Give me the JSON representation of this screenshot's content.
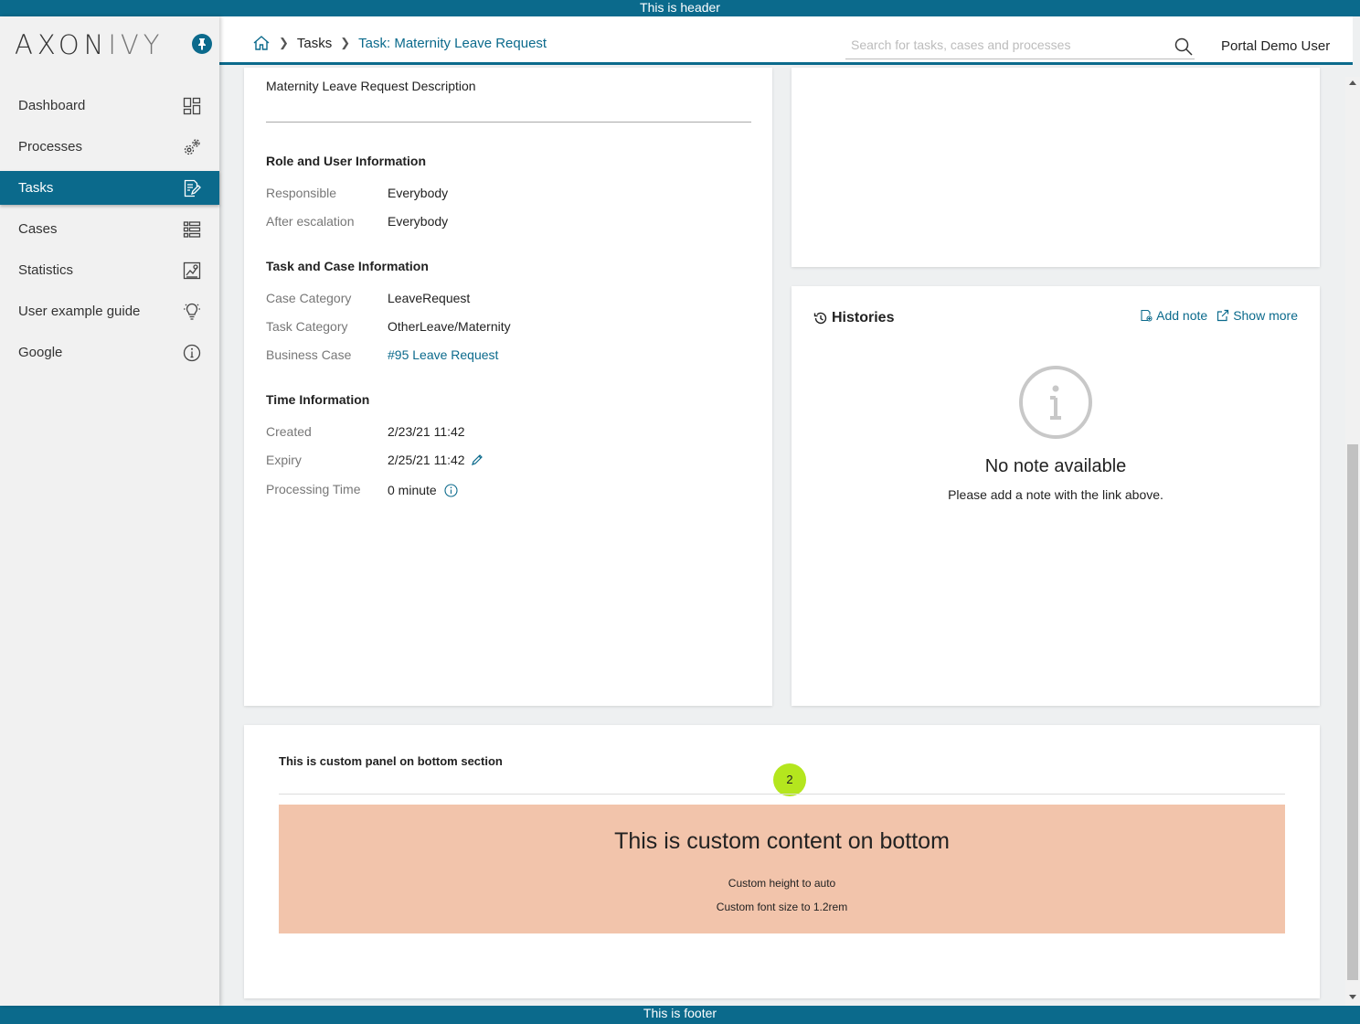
{
  "banners": {
    "header": "This is header",
    "footer": "This is footer"
  },
  "logo": {
    "axon": "AXON",
    "ivy": "IVY"
  },
  "sidebar": {
    "items": [
      {
        "label": "Dashboard",
        "icon": "dashboard-icon"
      },
      {
        "label": "Processes",
        "icon": "gears-icon"
      },
      {
        "label": "Tasks",
        "icon": "task-edit-icon",
        "active": true
      },
      {
        "label": "Cases",
        "icon": "list-icon"
      },
      {
        "label": "Statistics",
        "icon": "chart-icon"
      },
      {
        "label": "User example guide",
        "icon": "lightbulb-icon"
      },
      {
        "label": "Google",
        "icon": "info-icon"
      }
    ]
  },
  "topbar": {
    "breadcrumb": {
      "tasks": "Tasks",
      "current": "Task: Maternity Leave Request"
    },
    "search_placeholder": "Search for tasks, cases and processes",
    "user": "Portal Demo User"
  },
  "details": {
    "description": "Maternity Leave Request Description",
    "role_section": {
      "title": "Role and User Information",
      "responsible_label": "Responsible",
      "responsible_value": "Everybody",
      "escalation_label": "After escalation",
      "escalation_value": "Everybody"
    },
    "task_section": {
      "title": "Task and Case Information",
      "case_category_label": "Case Category",
      "case_category_value": "LeaveRequest",
      "task_category_label": "Task Category",
      "task_category_value": "OtherLeave/Maternity",
      "business_case_label": "Business Case",
      "business_case_value": "#95 Leave Request"
    },
    "time_section": {
      "title": "Time Information",
      "created_label": "Created",
      "created_value": "2/23/21 11:42",
      "expiry_label": "Expiry",
      "expiry_value": "2/25/21 11:42",
      "processing_label": "Processing Time",
      "processing_value": "0 minute"
    }
  },
  "histories": {
    "title": "Histories",
    "add_note": "Add note",
    "show_more": "Show more",
    "empty_title": "No note available",
    "empty_subtitle": "Please add a note with the link above."
  },
  "bottom_panel": {
    "title": "This is custom panel on bottom section",
    "badge": "2",
    "content_title": "This is custom content on bottom",
    "line1": "Custom height to auto",
    "line2": "Custom font size to 1.2rem"
  },
  "colors": {
    "primary": "#0b6a8c",
    "badge": "#b4e61e",
    "custom_content_bg": "#f2c4ab"
  }
}
